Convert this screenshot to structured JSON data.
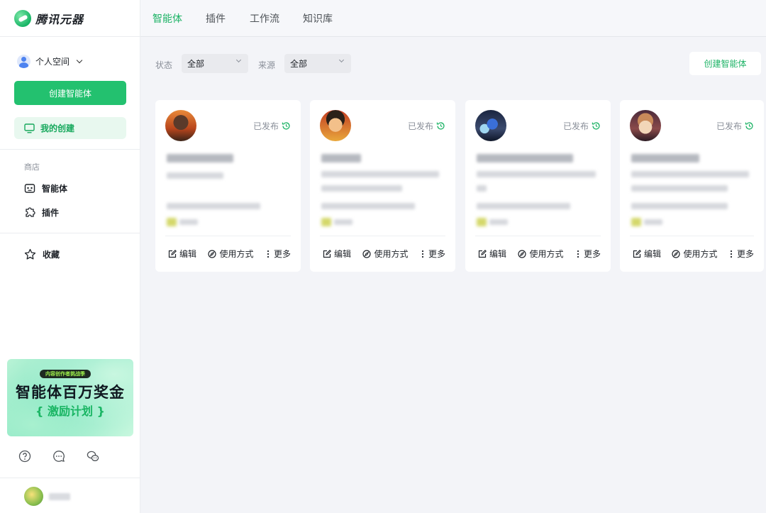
{
  "app": {
    "name": "腾讯元器"
  },
  "tabs": [
    {
      "label": "智能体",
      "active": true
    },
    {
      "label": "插件",
      "active": false
    },
    {
      "label": "工作流",
      "active": false
    },
    {
      "label": "知识库",
      "active": false
    }
  ],
  "sidebar": {
    "space_label": "个人空间",
    "create_label": "创建智能体",
    "mine_label": "我的创建",
    "store_section": "商店",
    "items": [
      {
        "label": "智能体",
        "icon": "robot-icon"
      },
      {
        "label": "插件",
        "icon": "puzzle-icon"
      },
      {
        "label": "收藏",
        "icon": "star-icon"
      }
    ],
    "banner": {
      "pill": "内容创作者挑战季",
      "title": "智能体百万奖金",
      "subtitle": "{ 激励计划 }"
    }
  },
  "filters": {
    "status_label": "状态",
    "status_value": "全部",
    "source_label": "来源",
    "source_value": "全部",
    "create_label": "创建智能体"
  },
  "cards": [
    {
      "status": "已发布",
      "edit": "编辑",
      "usage": "使用方式",
      "more": "更多"
    },
    {
      "status": "已发布",
      "edit": "编辑",
      "usage": "使用方式",
      "more": "更多"
    },
    {
      "status": "已发布",
      "edit": "编辑",
      "usage": "使用方式",
      "more": "更多"
    },
    {
      "status": "已发布",
      "edit": "编辑",
      "usage": "使用方式",
      "more": "更多"
    }
  ],
  "colors": {
    "accent": "#23c16f",
    "accent_text": "#1db366",
    "background": "#f3f4f8"
  }
}
